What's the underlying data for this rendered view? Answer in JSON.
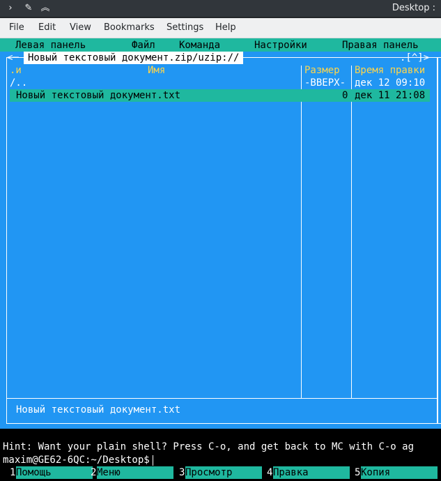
{
  "window": {
    "title": "Desktop : ",
    "icons": {
      "app": "terminal-icon",
      "pin": "pin-icon",
      "keep_above": "keep-above-icon"
    }
  },
  "menubar": {
    "items": [
      "File",
      "Edit",
      "View",
      "Bookmarks",
      "Settings",
      "Help"
    ]
  },
  "mc": {
    "menu": [
      "Левая панель",
      "Файл",
      "Команда",
      "Настройки",
      "Правая панель"
    ],
    "panel": {
      "path": "Новый текстовый документ.zip/uzip://",
      "left_mark": "<─",
      "right_mark": ".[^]>",
      "columns": {
        "dot": ".и",
        "name": "Имя",
        "size": "Размер",
        "mtime": "Время правки"
      },
      "rows": [
        {
          "name": "/..",
          "size": "-ВВЕРХ-",
          "mtime": "дек 12 09:10",
          "selected": false
        },
        {
          "name": "Новый текстовый документ.txt",
          "size": "0",
          "mtime": "дек 11 21:08",
          "selected": true
        }
      ],
      "status": "Новый текстовый документ.txt"
    },
    "hint": "Hint: Want your plain shell? Press C-o, and get back to MC with C-o ag",
    "prompt": "maxim@GE62-6QC:~/Desktop$",
    "fkeys": [
      {
        "num": "1",
        "label": "Помощь"
      },
      {
        "num": "2",
        "label": "Меню"
      },
      {
        "num": "3",
        "label": "Просмотр"
      },
      {
        "num": "4",
        "label": "Правка"
      },
      {
        "num": "5",
        "label": "Копия"
      }
    ]
  },
  "colors": {
    "panel_bg": "#2196f3",
    "menu_bg": "#1fb89f",
    "header_text": "#ffd54a",
    "terminal_bg": "#000000"
  }
}
